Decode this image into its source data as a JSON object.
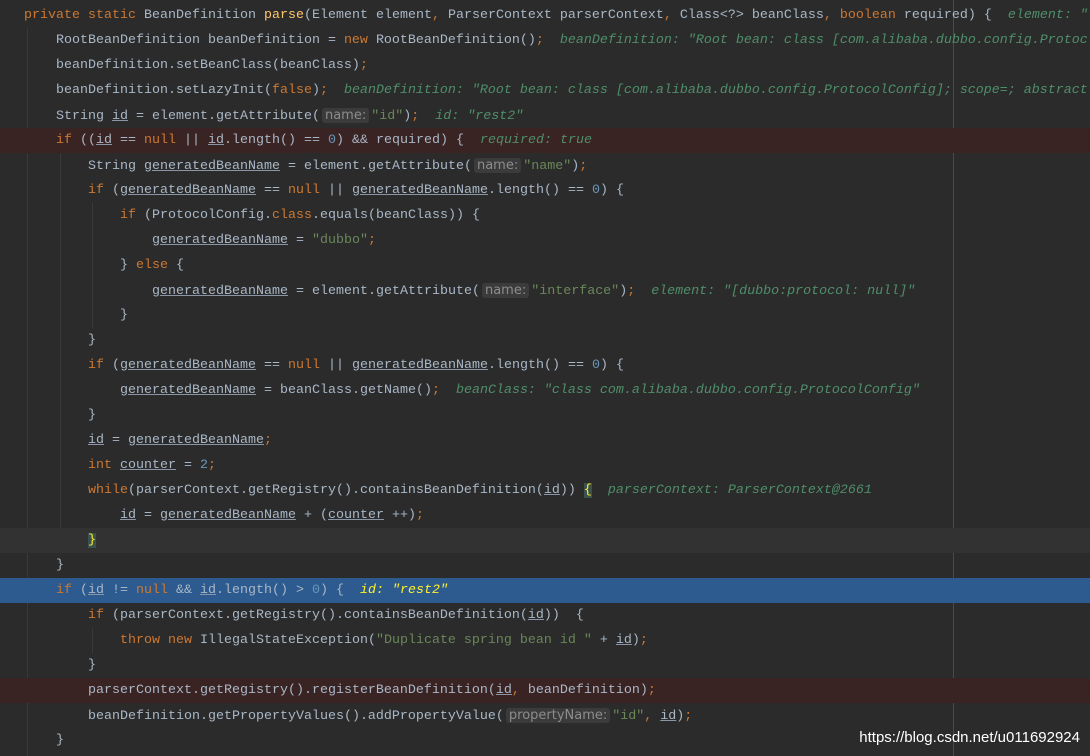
{
  "colors": {
    "background": "#2b2b2b",
    "text": "#a9b7c6",
    "keyword": "#cc7832",
    "string": "#6a8759",
    "number": "#6897bb",
    "method_declaration": "#ffc66d",
    "debug_value": "#4f8e6a",
    "selected_line": "#2d5b8f",
    "breakpoint_line": "#3a2323"
  },
  "lines": [
    {
      "indent": 0,
      "tokens": [
        [
          "k",
          "private static "
        ],
        [
          "t",
          "BeanDefinition "
        ],
        [
          "f",
          "parse"
        ],
        [
          "t",
          "(Element element"
        ],
        [
          "k",
          ", "
        ],
        [
          "t",
          "ParserContext parserContext"
        ],
        [
          "k",
          ", "
        ],
        [
          "t",
          "Class<?> beanClass"
        ],
        [
          "k",
          ", "
        ],
        [
          "k",
          "boolean "
        ],
        [
          "t",
          "required) {"
        ],
        [
          "d",
          "element: \""
        ]
      ]
    },
    {
      "indent": 1,
      "tokens": [
        [
          "t",
          "RootBeanDefinition beanDefinition = "
        ],
        [
          "k",
          "new "
        ],
        [
          "t",
          "RootBeanDefinition()"
        ],
        [
          "k",
          ";"
        ],
        [
          "d",
          "beanDefinition: \"Root bean: class [com.alibaba.dubbo.config.Protoc"
        ]
      ]
    },
    {
      "indent": 1,
      "tokens": [
        [
          "t",
          "beanDefinition.setBeanClass(beanClass)"
        ],
        [
          "k",
          ";"
        ]
      ]
    },
    {
      "indent": 1,
      "tokens": [
        [
          "t",
          "beanDefinition.setLazyInit("
        ],
        [
          "k",
          "false"
        ],
        [
          "t",
          ")"
        ],
        [
          "k",
          ";"
        ],
        [
          "d",
          "beanDefinition: \"Root bean: class [com.alibaba.dubbo.config.ProtocolConfig]; scope=; abstract"
        ]
      ]
    },
    {
      "indent": 1,
      "tokens": [
        [
          "t",
          "String "
        ],
        [
          "u",
          "id"
        ],
        [
          "t",
          " = element.getAttribute("
        ],
        [
          "h",
          "name:"
        ],
        [
          "s",
          "\"id\""
        ],
        [
          "t",
          ")"
        ],
        [
          "k",
          ";"
        ],
        [
          "d",
          "id: \"rest2\""
        ]
      ]
    },
    {
      "indent": 1,
      "state": "bp",
      "tokens": [
        [
          "k",
          "if "
        ],
        [
          "t",
          "(("
        ],
        [
          "u",
          "id"
        ],
        [
          "t",
          " == "
        ],
        [
          "k",
          "null "
        ],
        [
          "t",
          "|| "
        ],
        [
          "u",
          "id"
        ],
        [
          "t",
          ".length() == "
        ],
        [
          "n",
          "0"
        ],
        [
          "t",
          ") && required) {"
        ],
        [
          "d",
          "required: true"
        ]
      ]
    },
    {
      "indent": 2,
      "tokens": [
        [
          "t",
          "String "
        ],
        [
          "u",
          "generatedBeanName"
        ],
        [
          "t",
          " = element.getAttribute("
        ],
        [
          "h",
          "name:"
        ],
        [
          "s",
          "\"name\""
        ],
        [
          "t",
          ")"
        ],
        [
          "k",
          ";"
        ]
      ]
    },
    {
      "indent": 2,
      "tokens": [
        [
          "k",
          "if "
        ],
        [
          "t",
          "("
        ],
        [
          "u",
          "generatedBeanName"
        ],
        [
          "t",
          " == "
        ],
        [
          "k",
          "null "
        ],
        [
          "t",
          "|| "
        ],
        [
          "u",
          "generatedBeanName"
        ],
        [
          "t",
          ".length() == "
        ],
        [
          "n",
          "0"
        ],
        [
          "t",
          ") {"
        ]
      ]
    },
    {
      "indent": 3,
      "tokens": [
        [
          "k",
          "if "
        ],
        [
          "t",
          "(ProtocolConfig."
        ],
        [
          "k",
          "class"
        ],
        [
          "t",
          ".equals(beanClass)) {"
        ]
      ]
    },
    {
      "indent": 4,
      "tokens": [
        [
          "u",
          "generatedBeanName"
        ],
        [
          "t",
          " = "
        ],
        [
          "s",
          "\"dubbo\""
        ],
        [
          "k",
          ";"
        ]
      ]
    },
    {
      "indent": 3,
      "tokens": [
        [
          "t",
          "} "
        ],
        [
          "k",
          "else "
        ],
        [
          "t",
          "{"
        ]
      ]
    },
    {
      "indent": 4,
      "tokens": [
        [
          "u",
          "generatedBeanName"
        ],
        [
          "t",
          " = element.getAttribute("
        ],
        [
          "h",
          "name:"
        ],
        [
          "s",
          "\"interface\""
        ],
        [
          "t",
          ")"
        ],
        [
          "k",
          ";"
        ],
        [
          "d",
          "element: \"[dubbo:protocol: null]\""
        ]
      ]
    },
    {
      "indent": 3,
      "tokens": [
        [
          "t",
          "}"
        ]
      ]
    },
    {
      "indent": 2,
      "tokens": [
        [
          "t",
          "}"
        ]
      ]
    },
    {
      "indent": 2,
      "tokens": [
        [
          "k",
          "if "
        ],
        [
          "t",
          "("
        ],
        [
          "u",
          "generatedBeanName"
        ],
        [
          "t",
          " == "
        ],
        [
          "k",
          "null "
        ],
        [
          "t",
          "|| "
        ],
        [
          "u",
          "generatedBeanName"
        ],
        [
          "t",
          ".length() == "
        ],
        [
          "n",
          "0"
        ],
        [
          "t",
          ") {"
        ]
      ]
    },
    {
      "indent": 3,
      "tokens": [
        [
          "u",
          "generatedBeanName"
        ],
        [
          "t",
          " = beanClass.getName()"
        ],
        [
          "k",
          ";"
        ],
        [
          "d",
          "beanClass: \"class com.alibaba.dubbo.config.ProtocolConfig\""
        ]
      ]
    },
    {
      "indent": 2,
      "tokens": [
        [
          "t",
          "}"
        ]
      ]
    },
    {
      "indent": 2,
      "tokens": [
        [
          "u",
          "id"
        ],
        [
          "t",
          " = "
        ],
        [
          "u",
          "generatedBeanName"
        ],
        [
          "k",
          ";"
        ]
      ]
    },
    {
      "indent": 2,
      "tokens": [
        [
          "k",
          "int "
        ],
        [
          "u",
          "counter"
        ],
        [
          "t",
          " = "
        ],
        [
          "n",
          "2"
        ],
        [
          "k",
          ";"
        ]
      ]
    },
    {
      "indent": 2,
      "tokens": [
        [
          "k",
          "while"
        ],
        [
          "t",
          "(parserContext.getRegistry().containsBeanDefinition("
        ],
        [
          "u",
          "id"
        ],
        [
          "t",
          ")) "
        ],
        [
          "y",
          "{"
        ],
        [
          "d",
          "parserContext: ParserContext@2661"
        ]
      ]
    },
    {
      "indent": 3,
      "tokens": [
        [
          "u",
          "id"
        ],
        [
          "t",
          " = "
        ],
        [
          "u",
          "generatedBeanName"
        ],
        [
          "t",
          " + ("
        ],
        [
          "u",
          "counter"
        ],
        [
          "t",
          " ++)"
        ],
        [
          "k",
          ";"
        ]
      ]
    },
    {
      "indent": 2,
      "state": "cur",
      "tokens": [
        [
          "y",
          "}"
        ]
      ]
    },
    {
      "indent": 1,
      "tokens": [
        [
          "t",
          "}"
        ]
      ]
    },
    {
      "indent": 1,
      "state": "sel",
      "tokens": [
        [
          "k",
          "if "
        ],
        [
          "t",
          "("
        ],
        [
          "u",
          "id"
        ],
        [
          "t",
          " != "
        ],
        [
          "k",
          "null "
        ],
        [
          "t",
          "&& "
        ],
        [
          "u",
          "id"
        ],
        [
          "t",
          ".length() > "
        ],
        [
          "n",
          "0"
        ],
        [
          "t",
          ") {"
        ],
        [
          "d",
          "id: \"rest2\""
        ]
      ]
    },
    {
      "indent": 2,
      "tokens": [
        [
          "k",
          "if "
        ],
        [
          "t",
          "(parserContext.getRegistry().containsBeanDefinition("
        ],
        [
          "u",
          "id"
        ],
        [
          "t",
          "))  {"
        ]
      ]
    },
    {
      "indent": 3,
      "tokens": [
        [
          "k",
          "throw new "
        ],
        [
          "t",
          "IllegalStateException("
        ],
        [
          "s",
          "\"Duplicate spring bean id \""
        ],
        [
          "t",
          " + "
        ],
        [
          "u",
          "id"
        ],
        [
          "t",
          ")"
        ],
        [
          "k",
          ";"
        ]
      ]
    },
    {
      "indent": 2,
      "tokens": [
        [
          "t",
          "}"
        ]
      ]
    },
    {
      "indent": 2,
      "state": "bp",
      "tokens": [
        [
          "t",
          "parserContext.getRegistry().registerBeanDefinition("
        ],
        [
          "u",
          "id"
        ],
        [
          "k",
          ", "
        ],
        [
          "t",
          "beanDefinition)"
        ],
        [
          "k",
          ";"
        ]
      ]
    },
    {
      "indent": 2,
      "tokens": [
        [
          "t",
          "beanDefinition.getPropertyValues().addPropertyValue("
        ],
        [
          "h",
          "propertyName:"
        ],
        [
          "s",
          "\"id\""
        ],
        [
          "k",
          ", "
        ],
        [
          "u",
          "id"
        ],
        [
          "t",
          ")"
        ],
        [
          "k",
          ";"
        ]
      ]
    },
    {
      "indent": 1,
      "tokens": [
        [
          "t",
          "}"
        ]
      ]
    }
  ],
  "watermark": "https://blog.csdn.net/u011692924"
}
